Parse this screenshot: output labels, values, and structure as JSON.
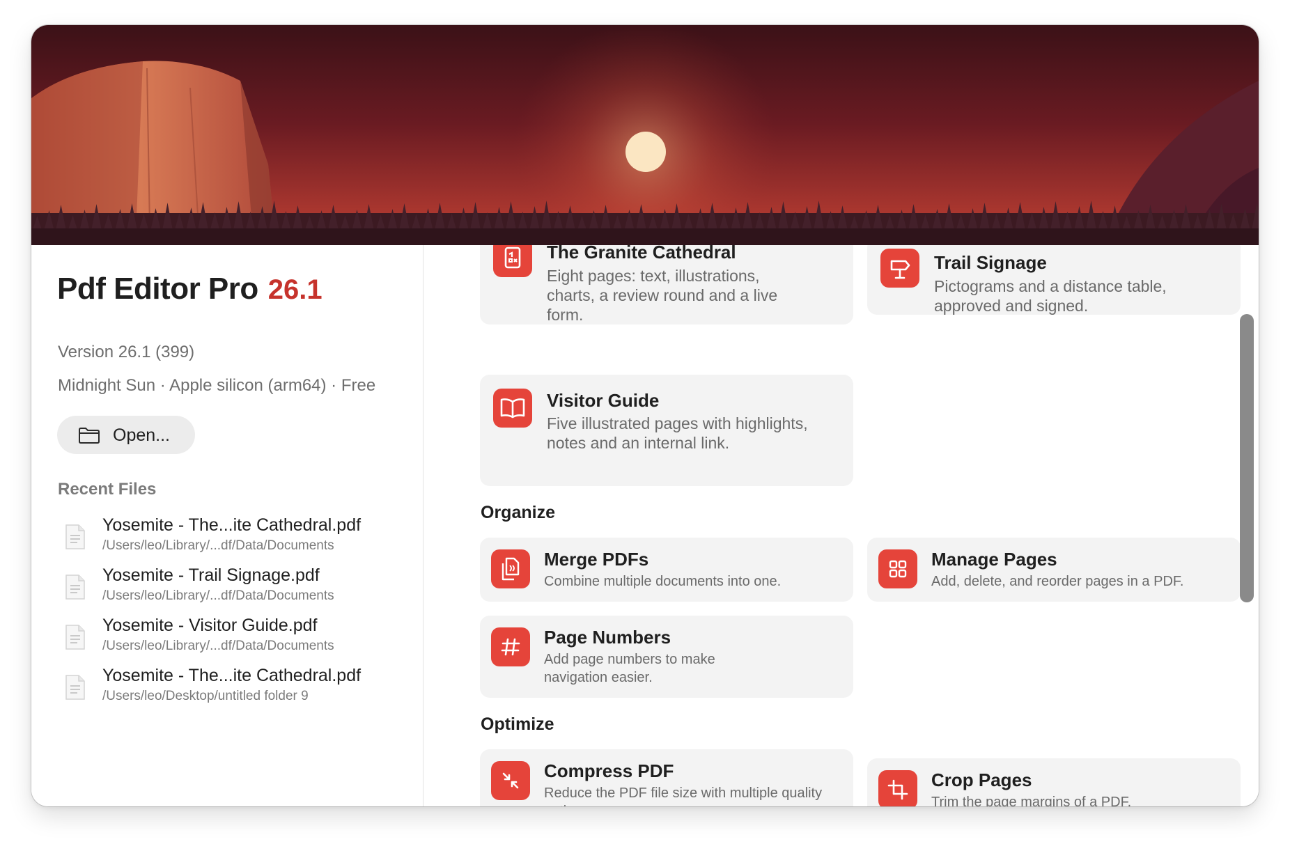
{
  "app": {
    "name": "Pdf Editor Pro",
    "version_badge": "26.1",
    "version_line": "Version 26.1 (399)",
    "build_line": "Midnight Sun · Apple silicon (arm64) · Free",
    "open_label": "Open...",
    "accent": "#e5443a"
  },
  "recent": {
    "heading": "Recent Files",
    "items": [
      {
        "name": "Yosemite - The...ite Cathedral.pdf",
        "path": "/Users/leo/Library/...df/Data/Documents"
      },
      {
        "name": "Yosemite - Trail Signage.pdf",
        "path": "/Users/leo/Library/...df/Data/Documents"
      },
      {
        "name": "Yosemite - Visitor Guide.pdf",
        "path": "/Users/leo/Library/...df/Data/Documents"
      },
      {
        "name": "Yosemite - The...ite Cathedral.pdf",
        "path": "/Users/leo/Desktop/untitled folder 9"
      }
    ]
  },
  "samples": [
    {
      "title": "The Granite Cathedral",
      "desc": "Eight pages: text, illustrations, charts, a review round and a live form.",
      "icon": "document-form-icon"
    },
    {
      "title": "Trail Signage",
      "desc": "Pictograms and a distance table, approved and signed.",
      "icon": "signpost-icon"
    },
    {
      "title": "Visitor Guide",
      "desc": "Five illustrated pages with highlights, notes and an internal link.",
      "icon": "open-book-icon"
    }
  ],
  "organize": {
    "heading": "Organize",
    "tools": [
      {
        "title": "Merge PDFs",
        "desc": "Combine multiple documents into one.",
        "icon": "merge-documents-icon"
      },
      {
        "title": "Manage Pages",
        "desc": "Add, delete, and reorder pages in a PDF.",
        "icon": "grid-pages-icon"
      },
      {
        "title": "Page Numbers",
        "desc": "Add page numbers to make navigation easier.",
        "icon": "hash-icon"
      }
    ]
  },
  "optimize": {
    "heading": "Optimize",
    "tools": [
      {
        "title": "Compress PDF",
        "desc": "Reduce the PDF file size with multiple quality options.",
        "icon": "compress-arrows-icon"
      },
      {
        "title": "Crop Pages",
        "desc": "Trim the page margins of a PDF.",
        "icon": "crop-icon"
      }
    ]
  }
}
